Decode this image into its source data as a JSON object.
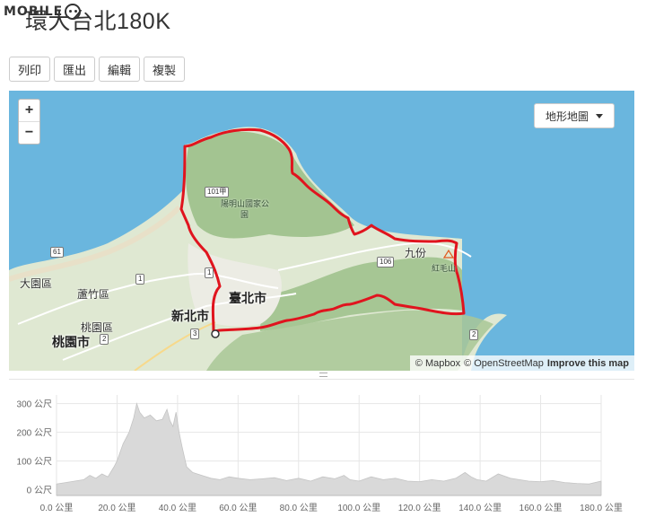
{
  "logo": {
    "text": "MOBILE",
    "icon": "smiley-face-icon"
  },
  "page": {
    "title": "環大台北180K"
  },
  "toolbar": {
    "print": "列印",
    "export": "匯出",
    "edit": "編輯",
    "copy": "複製"
  },
  "map": {
    "zoom_in": "+",
    "zoom_out": "−",
    "layer_select": "地形地圖",
    "attribution": {
      "mapbox": "© Mapbox",
      "osm": "© OpenStreetMap",
      "improve": "Improve this map"
    },
    "labels": {
      "park": "陽明山國家公",
      "park2": "園",
      "jiufen": "九份",
      "hongmao": "紅毛山",
      "dayuan": "大園區",
      "luzhu": "蘆竹區",
      "taoyuan_dist": "桃園區",
      "taoyuan_city": "桃園市",
      "newtaipei": "新北市",
      "taipei": "臺北市"
    },
    "shields": {
      "r101": "101甲",
      "r61": "61",
      "r1a": "1",
      "r1b": "1",
      "r106": "106",
      "r2a": "2",
      "r2b": "2",
      "r3": "3"
    },
    "colors": {
      "water": "#6ab6de",
      "route": "#e0141e",
      "land": "#dfe8d2",
      "mountain": "#9cc08a"
    }
  },
  "chart_data": {
    "type": "area",
    "x_unit": "公里",
    "y_unit": "公尺",
    "xlim": [
      0,
      180
    ],
    "ylim": [
      -20,
      330
    ],
    "x_ticks": [
      "0.0 公里",
      "20.0 公里",
      "40.0 公里",
      "60.0 公里",
      "80.0 公里",
      "100.0 公里",
      "120.0 公里",
      "140.0 公里",
      "160.0 公里",
      "180.0 公里"
    ],
    "y_ticks": [
      "300 公尺",
      "200 公尺",
      "100 公尺",
      "0 公尺"
    ],
    "x": [
      0,
      3,
      6,
      9,
      11,
      13,
      15,
      17,
      19,
      20,
      22,
      24,
      25.5,
      26.5,
      27.5,
      29,
      31,
      33,
      35,
      36.5,
      37.5,
      38.5,
      39.5,
      40.5,
      41.5,
      43,
      45,
      48,
      51,
      54,
      57,
      60,
      64,
      68,
      72,
      76,
      80,
      84,
      88,
      92,
      95,
      97,
      100,
      104,
      108,
      112,
      116,
      120,
      124,
      128,
      132,
      135,
      137,
      139,
      142,
      146,
      150,
      153,
      156,
      160,
      164,
      168,
      172,
      176,
      180
    ],
    "y": [
      20,
      25,
      30,
      35,
      50,
      40,
      55,
      45,
      80,
      100,
      160,
      200,
      250,
      300,
      270,
      250,
      260,
      240,
      245,
      280,
      240,
      220,
      270,
      200,
      150,
      80,
      60,
      50,
      40,
      35,
      45,
      40,
      35,
      38,
      42,
      32,
      40,
      30,
      45,
      38,
      50,
      35,
      30,
      45,
      35,
      40,
      30,
      28,
      35,
      30,
      40,
      60,
      45,
      35,
      30,
      55,
      40,
      35,
      30,
      28,
      32,
      25,
      22,
      20,
      30
    ],
    "fill_color": "#d9d9d9",
    "grid": true
  }
}
